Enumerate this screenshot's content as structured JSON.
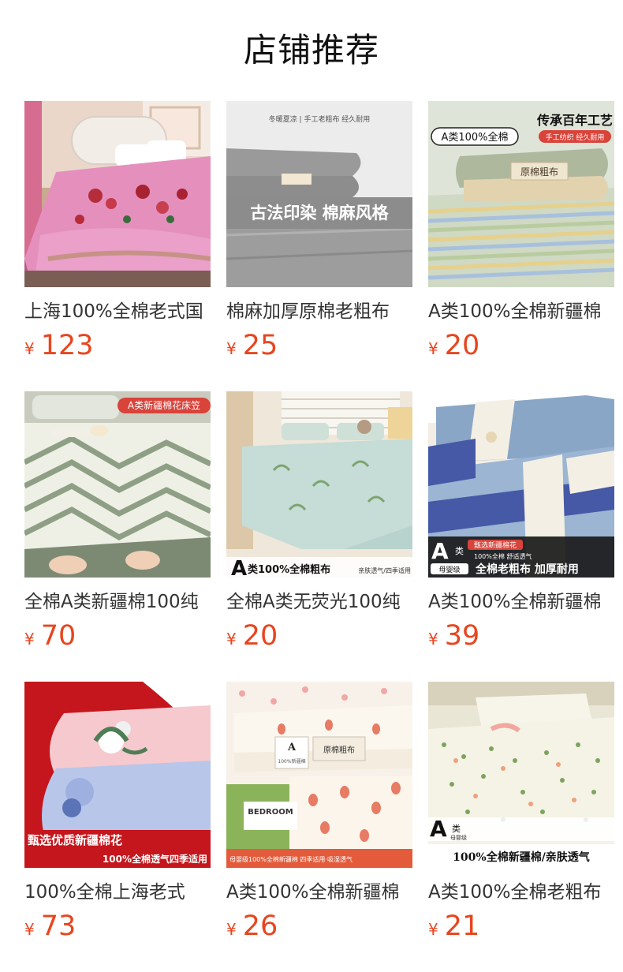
{
  "section": {
    "title": "店铺推荐"
  },
  "currency": "¥",
  "products": [
    {
      "name": "上海100%全棉老式国",
      "price": "123",
      "image_text": []
    },
    {
      "name": "棉麻加厚原棉老粗布",
      "price": "25",
      "image_text": [
        "冬暖夏凉 | 手工老粗布 经久耐用",
        "古法印染 棉麻风格"
      ]
    },
    {
      "name": "A类100%全棉新疆棉",
      "price": "20",
      "image_text": [
        "A类100%全棉",
        "传承百年工艺",
        "手工纺织 经久耐用",
        "原棉粗布"
      ]
    },
    {
      "name": "全棉A类新疆棉100纯",
      "price": "70",
      "image_text": [
        "A类新疆棉花床笠"
      ]
    },
    {
      "name": "全棉A类无荧光100纯",
      "price": "20",
      "image_text": [
        "A",
        "类100%全棉粗布",
        "亲肤透气/四季适用"
      ]
    },
    {
      "name": "A类100%全棉新疆棉",
      "price": "39",
      "image_text": [
        "甄选新疆棉花",
        "100%全棉 舒适透气",
        "A",
        "类",
        "母婴级",
        "全棉老粗布 加厚耐用"
      ]
    },
    {
      "name": "100%全棉上海老式",
      "price": "73",
      "image_text": [
        "甄选优质新疆棉花",
        "100%全棉透气四季适用"
      ]
    },
    {
      "name": "A类100%全棉新疆棉",
      "price": "26",
      "image_text": [
        "BEDROOM",
        "原棉粗布",
        "A",
        "100%新疆棉",
        "母婴级100%全棉新疆棉 四季适用·吸湿透气"
      ]
    },
    {
      "name": "A类100%全棉老粗布",
      "price": "21",
      "image_text": [
        "A",
        "类",
        "母婴级",
        "100%全棉新疆棉/亲肤透气"
      ]
    }
  ]
}
